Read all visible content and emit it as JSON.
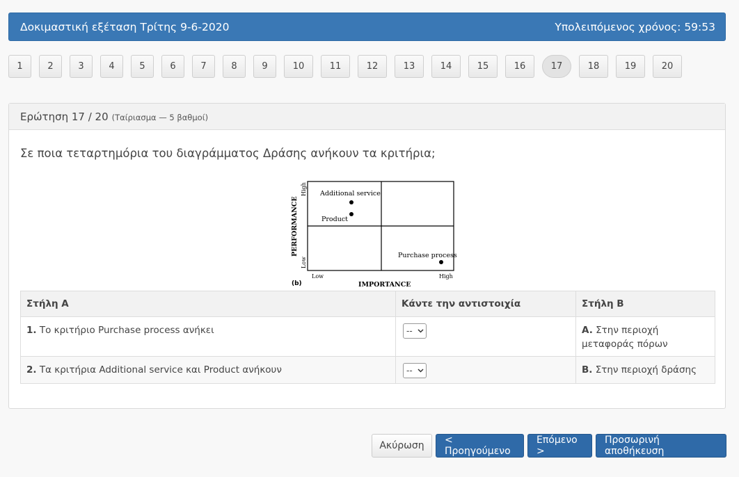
{
  "header": {
    "title": "Δοκιμαστική εξέταση Τρίτης 9-6-2020",
    "timer": "Υπολειπόμενος χρόνος: 59:53"
  },
  "pager": {
    "pages": [
      "1",
      "2",
      "3",
      "4",
      "5",
      "6",
      "7",
      "8",
      "9",
      "10",
      "11",
      "12",
      "13",
      "14",
      "15",
      "16",
      "17",
      "18",
      "19",
      "20"
    ],
    "current": "17"
  },
  "question": {
    "header": "Ερώτηση 17 / 20",
    "meta": "(Ταίριασμα — 5 βαθμοί)",
    "text": "Σε ποια τεταρτημόρια του διαγράμματος Δράσης ανήκουν τα κριτήρια;"
  },
  "diagram": {
    "y_label": "PERFORMANCE",
    "x_label": "IMPORTANCE",
    "y_high": "High",
    "y_low": "Low",
    "x_low": "Low",
    "x_high": "High",
    "panel_label": "(b)",
    "points": [
      "Additional service",
      "Product",
      "Purchase process"
    ]
  },
  "table": {
    "col_a": "Στήλη Α",
    "col_match": "Κάντε την αντιστοιχία",
    "col_b": "Στήλη Β",
    "rows": [
      {
        "num": "1.",
        "text": "Το κριτήριο Purchase process ανήκει",
        "select": "--",
        "b_letter": "A.",
        "b_text": "Στην περιοχή μεταφοράς πόρων"
      },
      {
        "num": "2.",
        "text": "Τα κριτήρια Additional service και Product ανήκουν",
        "select": "--",
        "b_letter": "B.",
        "b_text": "Στην περιοχή δράσης"
      }
    ]
  },
  "buttons": {
    "cancel": "Ακύρωση",
    "prev": "< Προηγούμενο",
    "next": "Επόμενο >",
    "save": "Προσωρινή αποθήκευση"
  }
}
